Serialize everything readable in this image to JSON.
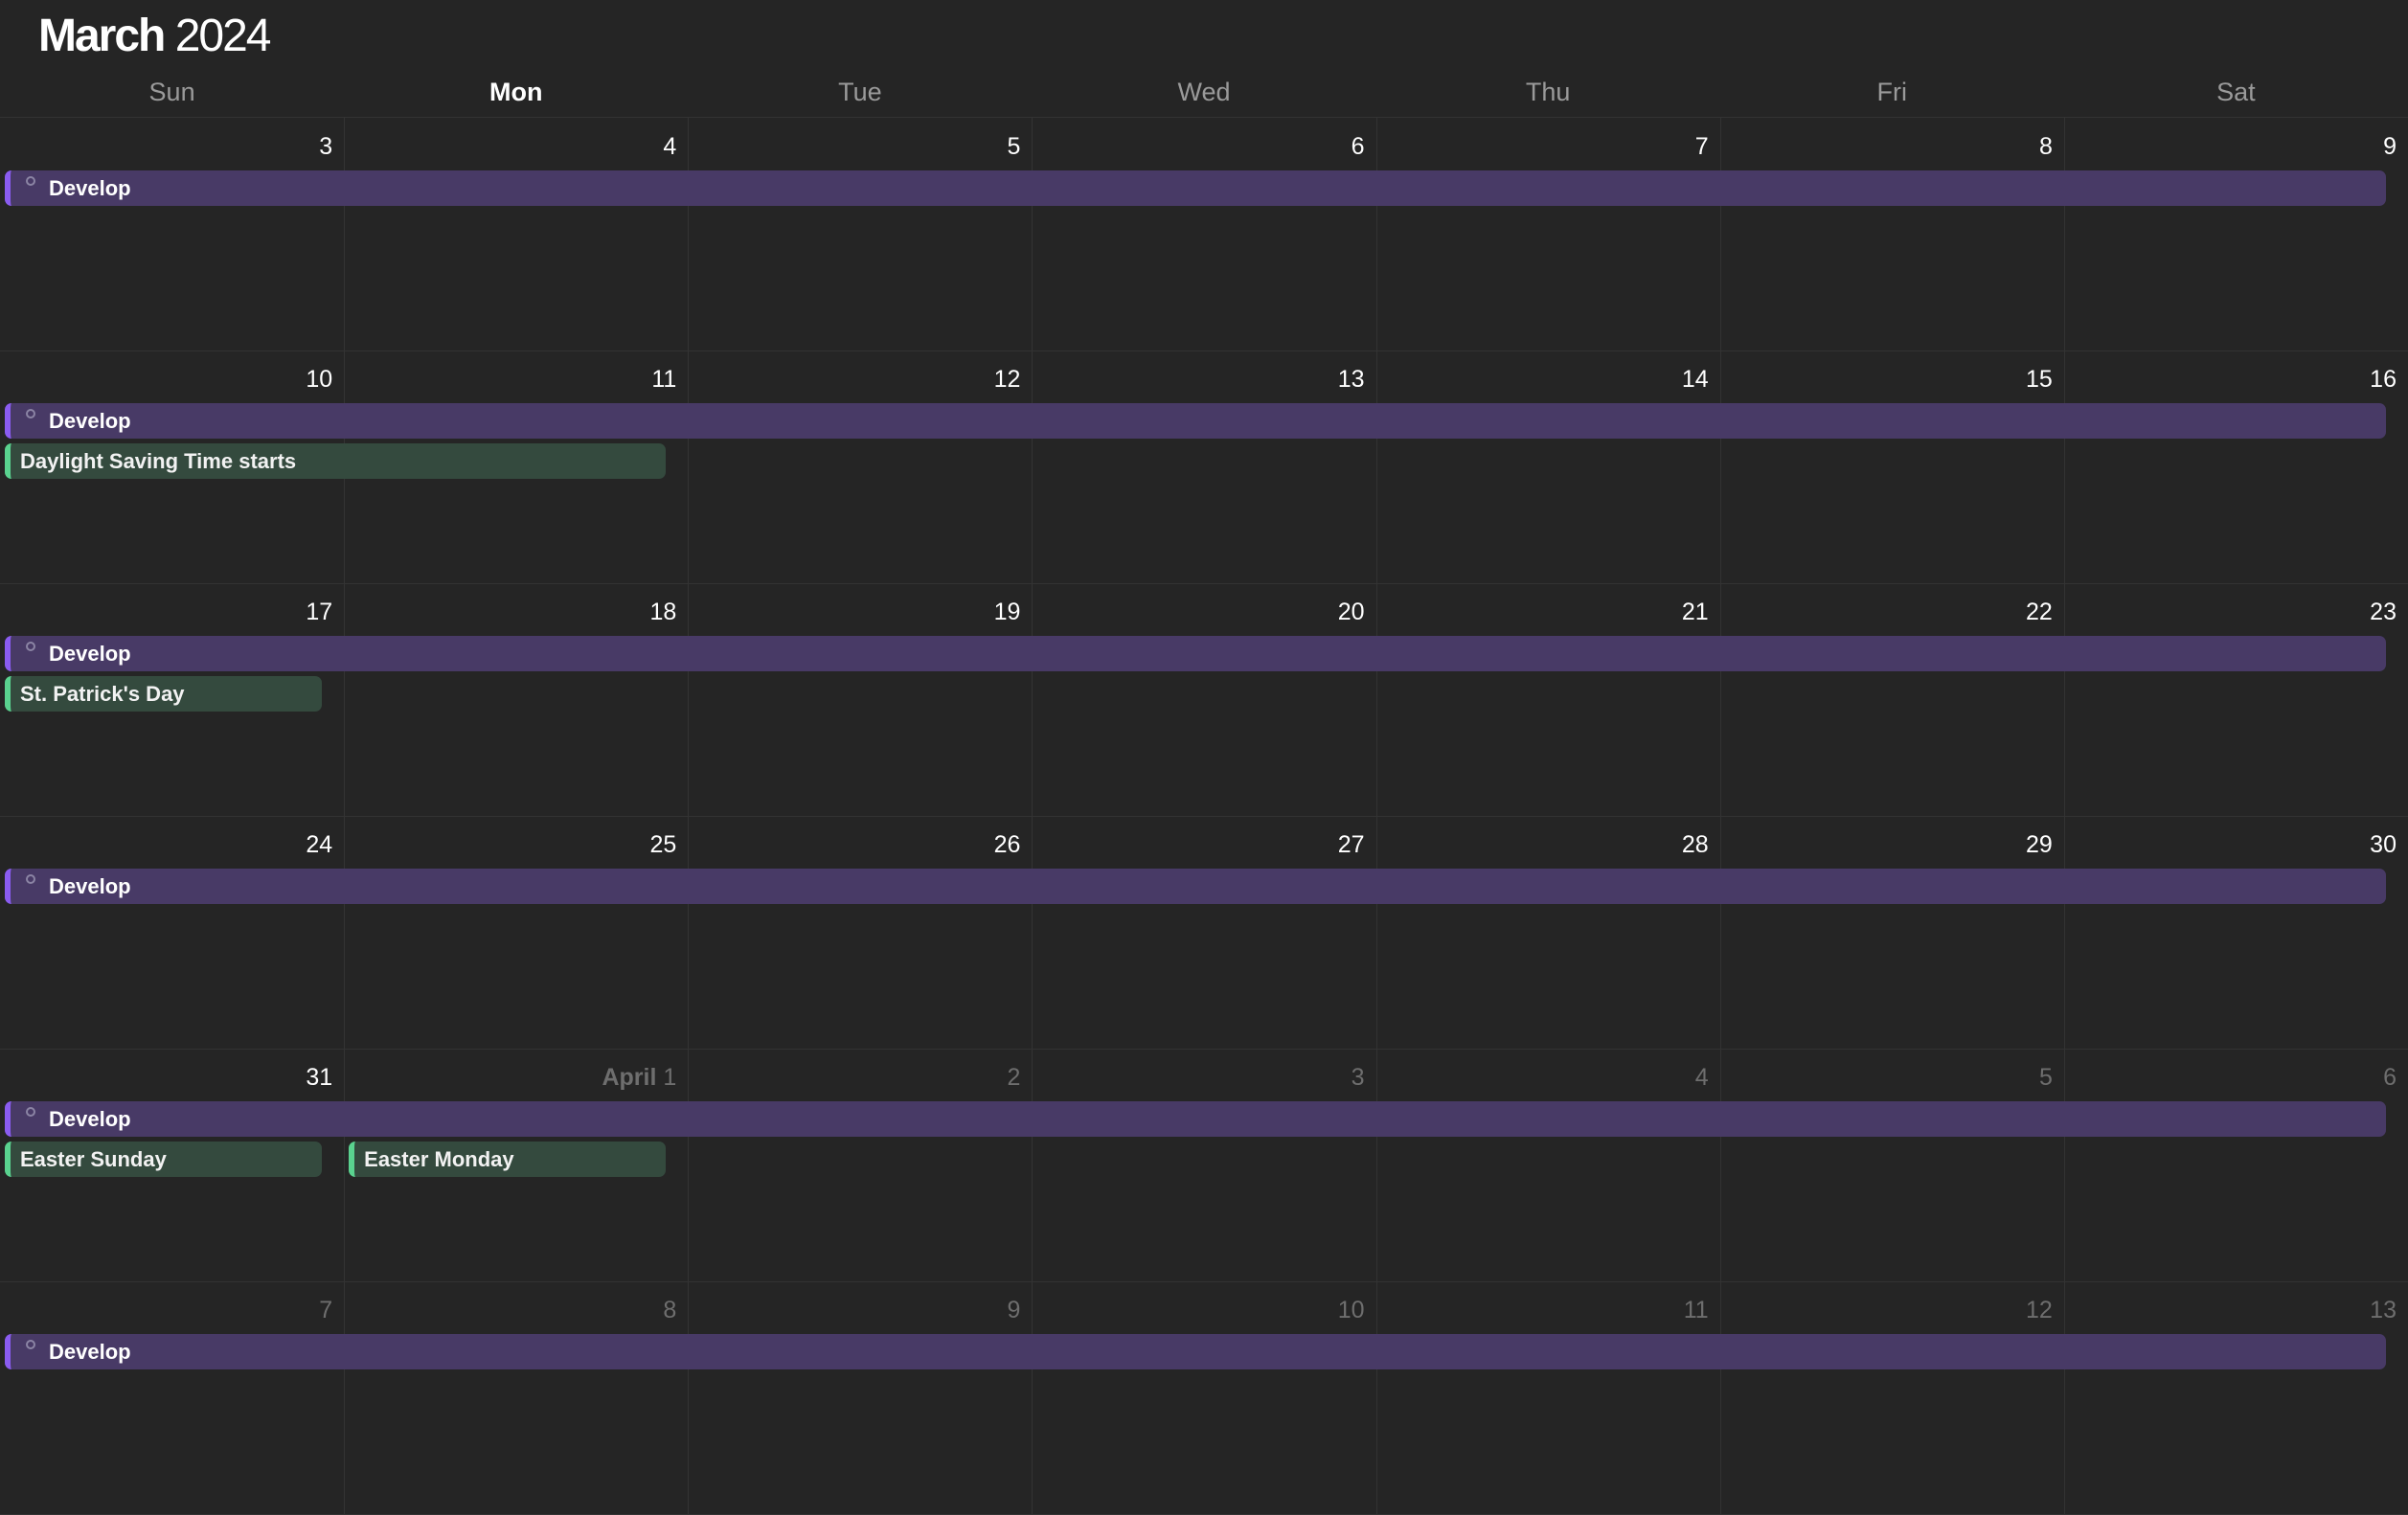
{
  "header": {
    "month": "March",
    "year": "2024"
  },
  "weekdays": [
    {
      "label": "Sun",
      "today": false
    },
    {
      "label": "Mon",
      "today": true
    },
    {
      "label": "Tue",
      "today": false
    },
    {
      "label": "Wed",
      "today": false
    },
    {
      "label": "Thu",
      "today": false
    },
    {
      "label": "Fri",
      "today": false
    },
    {
      "label": "Sat",
      "today": false
    }
  ],
  "weeks": [
    {
      "days": [
        {
          "day": "3",
          "other_month": false
        },
        {
          "day": "4",
          "other_month": false
        },
        {
          "day": "5",
          "other_month": false
        },
        {
          "day": "6",
          "other_month": false
        },
        {
          "day": "7",
          "other_month": false
        },
        {
          "day": "8",
          "other_month": false
        },
        {
          "day": "9",
          "other_month": false
        }
      ],
      "events": [
        {
          "title": "Develop",
          "kind": "develop",
          "start_col": 0,
          "span": 7,
          "row": 0
        }
      ]
    },
    {
      "days": [
        {
          "day": "10",
          "other_month": false
        },
        {
          "day": "11",
          "other_month": false
        },
        {
          "day": "12",
          "other_month": false
        },
        {
          "day": "13",
          "other_month": false
        },
        {
          "day": "14",
          "other_month": false
        },
        {
          "day": "15",
          "other_month": false
        },
        {
          "day": "16",
          "other_month": false
        }
      ],
      "events": [
        {
          "title": "Develop",
          "kind": "develop",
          "start_col": 0,
          "span": 7,
          "row": 0
        },
        {
          "title": "Daylight Saving Time starts",
          "kind": "holiday",
          "start_col": 0,
          "span": 2,
          "row": 1
        }
      ]
    },
    {
      "days": [
        {
          "day": "17",
          "other_month": false
        },
        {
          "day": "18",
          "other_month": false
        },
        {
          "day": "19",
          "other_month": false
        },
        {
          "day": "20",
          "other_month": false
        },
        {
          "day": "21",
          "other_month": false
        },
        {
          "day": "22",
          "other_month": false
        },
        {
          "day": "23",
          "other_month": false
        }
      ],
      "events": [
        {
          "title": "Develop",
          "kind": "develop",
          "start_col": 0,
          "span": 7,
          "row": 0
        },
        {
          "title": "St. Patrick's Day",
          "kind": "holiday",
          "start_col": 0,
          "span": 1,
          "row": 1
        }
      ]
    },
    {
      "days": [
        {
          "day": "24",
          "other_month": false
        },
        {
          "day": "25",
          "other_month": false
        },
        {
          "day": "26",
          "other_month": false
        },
        {
          "day": "27",
          "other_month": false
        },
        {
          "day": "28",
          "other_month": false
        },
        {
          "day": "29",
          "other_month": false
        },
        {
          "day": "30",
          "other_month": false
        }
      ],
      "events": [
        {
          "title": "Develop",
          "kind": "develop",
          "start_col": 0,
          "span": 7,
          "row": 0
        }
      ]
    },
    {
      "days": [
        {
          "day": "31",
          "other_month": false
        },
        {
          "day": "1",
          "month_label": "April",
          "other_month": true
        },
        {
          "day": "2",
          "other_month": true
        },
        {
          "day": "3",
          "other_month": true
        },
        {
          "day": "4",
          "other_month": true
        },
        {
          "day": "5",
          "other_month": true
        },
        {
          "day": "6",
          "other_month": true
        }
      ],
      "events": [
        {
          "title": "Develop",
          "kind": "develop",
          "start_col": 0,
          "span": 7,
          "row": 0
        },
        {
          "title": "Easter Sunday",
          "kind": "holiday",
          "start_col": 0,
          "span": 1,
          "row": 1
        },
        {
          "title": "Easter Monday",
          "kind": "holiday",
          "start_col": 1,
          "span": 1,
          "row": 1
        }
      ]
    },
    {
      "days": [
        {
          "day": "7",
          "other_month": true
        },
        {
          "day": "8",
          "other_month": true
        },
        {
          "day": "9",
          "other_month": true
        },
        {
          "day": "10",
          "other_month": true
        },
        {
          "day": "11",
          "other_month": true
        },
        {
          "day": "12",
          "other_month": true
        },
        {
          "day": "13",
          "other_month": true
        }
      ],
      "events": [
        {
          "title": "Develop",
          "kind": "develop",
          "start_col": 0,
          "span": 7,
          "row": 0
        }
      ]
    }
  ],
  "colors": {
    "background": "#252525",
    "develop_fill": "#483a66",
    "develop_accent": "#8a5cf0",
    "holiday_fill": "#344a3e",
    "holiday_accent": "#5ad28f",
    "grid_line": "#333333",
    "muted_text": "#6e6e6e"
  },
  "icons": {
    "develop_event": "circle-outline-icon"
  }
}
